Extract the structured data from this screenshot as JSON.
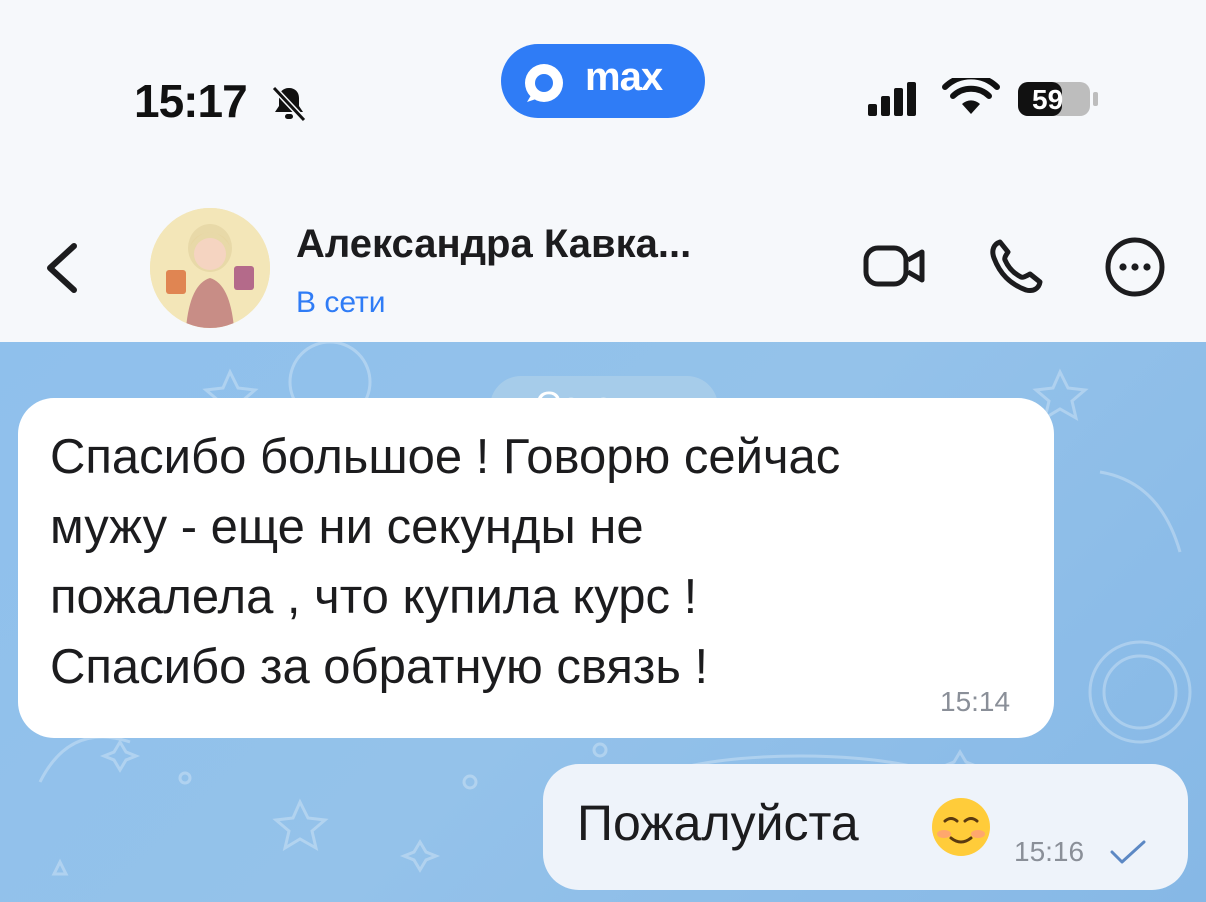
{
  "status_bar": {
    "time": "15:17",
    "app_name": "max",
    "battery": "59"
  },
  "header": {
    "contact_name": "Александра Кавка...",
    "presence": "В сети"
  },
  "chat": {
    "date_separator": "Сегодня",
    "messages": [
      {
        "direction": "incoming",
        "text": "Спасибо большое ! Говорю сейчас\nмужу - еще ни секунды не\nпожалела , что купила курс !\nСпасибо за обратную связь !",
        "time": "15:14"
      },
      {
        "direction": "outgoing",
        "text": "Пожалуйста",
        "emoji": "smiling-face-icon",
        "time": "15:16",
        "status": "sent-check-icon"
      }
    ]
  },
  "colors": {
    "accent": "#2f7cf6",
    "chat_bg": "#8fc0ec",
    "bubble_in": "#ffffff",
    "bubble_out": "#eef3fa"
  }
}
